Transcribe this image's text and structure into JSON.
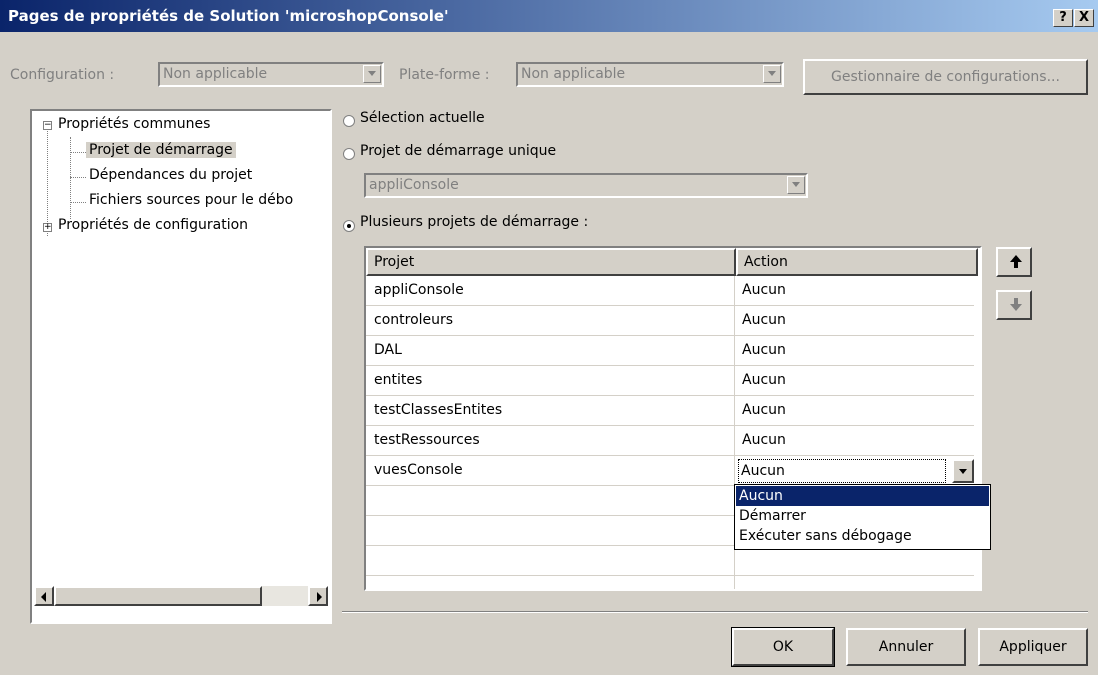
{
  "window": {
    "title": "Pages de propriétés de Solution 'microshopConsole'",
    "help_label": "?",
    "close_label": "X"
  },
  "toolbar": {
    "configuration_label": "Configuration :",
    "configuration_value": "Non applicable",
    "platform_label": "Plate-forme :",
    "platform_value": "Non applicable",
    "config_manager_label": "Gestionnaire de configurations..."
  },
  "tree": {
    "items": [
      {
        "label": "Propriétés communes"
      },
      {
        "label": "Projet de démarrage"
      },
      {
        "label": "Dépendances du projet"
      },
      {
        "label": "Fichiers sources pour le débo"
      },
      {
        "label": "Propriétés de configuration"
      }
    ]
  },
  "options": {
    "current_selection": "Sélection actuelle",
    "single_project": "Projet de démarrage unique",
    "single_project_value": "appliConsole",
    "multiple_projects": "Plusieurs projets de démarrage :"
  },
  "grid": {
    "headers": [
      "Projet",
      "Action"
    ],
    "rows": [
      {
        "project": "appliConsole",
        "action": "Aucun"
      },
      {
        "project": "controleurs",
        "action": "Aucun"
      },
      {
        "project": "DAL",
        "action": "Aucun"
      },
      {
        "project": "entites",
        "action": "Aucun"
      },
      {
        "project": "testClassesEntites",
        "action": "Aucun"
      },
      {
        "project": "testRessources",
        "action": "Aucun"
      },
      {
        "project": "vuesConsole",
        "action": "Aucun"
      }
    ],
    "dropdown_options": [
      "Aucun",
      "Démarrer",
      "Exécuter sans débogage"
    ]
  },
  "buttons": {
    "ok": "OK",
    "cancel": "Annuler",
    "apply": "Appliquer"
  },
  "colors": {
    "titlebar_start": "#0a246a",
    "titlebar_end": "#a6caf0",
    "selection": "#0a246a",
    "face": "#d4d0c8"
  }
}
